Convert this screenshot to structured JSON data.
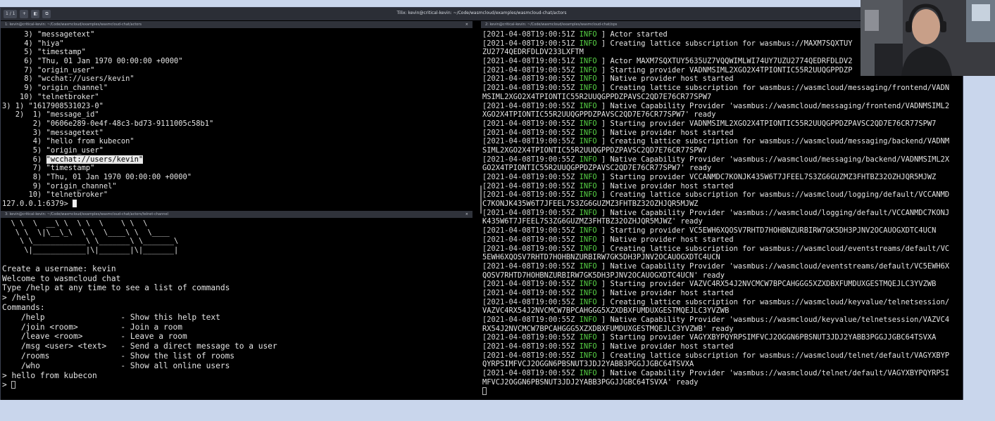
{
  "titlebar": {
    "tab_counter": "1 / 1",
    "title": "Tilix: kevin@critical-kevin: ~/Code/wasmcloud/examples/wasmcloud-chat/actors"
  },
  "panes": {
    "top_left_header": "1: kevin@critical-kevin: ~/Code/wasmcloud/examples/wasmcloud-chat/actors",
    "right_header": "2: kevin@critical-kevin: ~/Code/wasmcloud/examples/wasmcloud-chat/ops",
    "bottom_left_header": "3: kevin@critical-kevin: ~/Code/wasmcloud/examples/wasmcloud-chat/actors/telnet-channel",
    "close_glyph": "×"
  },
  "redis": {
    "lines": [
      "     3) \"messagetext\"",
      "     4) \"hiya\"",
      "     5) \"timestamp\"",
      "     6) \"Thu, 01 Jan 1970 00:00:00 +0000\"",
      "     7) \"origin_user\"",
      "     8) \"wcchat://users/kevin\"",
      "     9) \"origin_channel\"",
      "    10) \"telnetbroker\"",
      "3) 1) \"1617908531023-0\"",
      "   2)  1) \"message_id\"",
      "       2) \"0606e289-0e4f-48c3-bd73-9111005c58b1\"",
      "       3) \"messagetext\"",
      "       4) \"hello from kubecon\"",
      "       5) \"origin_user\""
    ],
    "hl_prefix": "       6) ",
    "hl_text": "\"wcchat://users/kevin\"",
    "lines_after": [
      "       7) \"timestamp\"",
      "       8) \"Thu, 01 Jan 1970 00:00:00 +0000\"",
      "       9) \"origin_channel\"",
      "      10) \"telnetbroker\""
    ],
    "prompt": "127.0.0.1:6379> "
  },
  "chat": {
    "ascii": [
      "  \\ \\  \\  __\\ \\  \\ \\  \\    \\ \\  \\",
      "   \\ \\  \\|\\__\\_\\  \\ \\  \\____\\ \\  \\____",
      "    \\ \\____________\\ \\_______\\ \\_______\\",
      "     \\|____________|\\|_______|\\|_______|"
    ],
    "lines": [
      "Create a username: kevin",
      "Welcome to wasmcloud chat",
      "Type /help at any time to see a list of commands",
      "> /help",
      "Commands:",
      "    /help                - Show this help text",
      "    /join <room>         - Join a room",
      "    /leave <room>        - Leave a room",
      "    /msg <user> <text>   - Send a direct message to a user",
      "    /rooms               - Show the list of rooms",
      "    /who                 - Show all online users",
      "> hello from kubecon"
    ],
    "prompt": "> "
  },
  "log": {
    "lines": [
      {
        "ts": "[2021-04-08T19:00:51Z",
        "lvl": "INFO",
        "msg": " ] Actor started"
      },
      {
        "ts": "[2021-04-08T19:00:51Z",
        "lvl": "INFO",
        "msg": " ] Creating lattice subscription for wasmbus://MAXM7SQXTUY"
      },
      {
        "ts": "",
        "lvl": "",
        "msg": "ZU2774QEDRFDLDV233LXFTM"
      },
      {
        "ts": "[2021-04-08T19:00:51Z",
        "lvl": "INFO",
        "msg": " ] Actor MAXM7SQXTUY5635UZ7VQQWIMLWI74UY7UZU2774QEDRFDLDV2"
      },
      {
        "ts": "[2021-04-08T19:00:55Z",
        "lvl": "INFO",
        "msg": " ] Starting provider VADNMSIML2XGO2X4TPIONTIC55R2UUQGPPDZP"
      },
      {
        "ts": "[2021-04-08T19:00:55Z",
        "lvl": "INFO",
        "msg": " ] Native provider host started"
      },
      {
        "ts": "[2021-04-08T19:00:55Z",
        "lvl": "INFO",
        "msg": " ] Creating lattice subscription for wasmbus://wasmcloud/messaging/frontend/VADN"
      },
      {
        "ts": "",
        "lvl": "",
        "msg": "MSIML2XGO2X4TPIONTIC55R2UUQGPPDZPAVSC2QD7E76CR77SPW7"
      },
      {
        "ts": "[2021-04-08T19:00:55Z",
        "lvl": "INFO",
        "msg": " ] Native Capability Provider 'wasmbus://wasmcloud/messaging/frontend/VADNMSIML2"
      },
      {
        "ts": "",
        "lvl": "",
        "msg": "XGO2X4TPIONTIC55R2UUQGPPDZPAVSC2QD7E76CR77SPW7' ready"
      },
      {
        "ts": "[2021-04-08T19:00:55Z",
        "lvl": "INFO",
        "msg": " ] Starting provider VADNMSIML2XGO2X4TPIONTIC55R2UUQGPPDZPAVSC2QD7E76CR77SPW7"
      },
      {
        "ts": "[2021-04-08T19:00:55Z",
        "lvl": "INFO",
        "msg": " ] Native provider host started"
      },
      {
        "ts": "[2021-04-08T19:00:55Z",
        "lvl": "INFO",
        "msg": " ] Creating lattice subscription for wasmbus://wasmcloud/messaging/backend/VADNM"
      },
      {
        "ts": "",
        "lvl": "",
        "msg": "SIML2XGO2X4TPIONTIC55R2UUQGPPDZPAVSC2QD7E76CR77SPW7"
      },
      {
        "ts": "[2021-04-08T19:00:55Z",
        "lvl": "INFO",
        "msg": " ] Native Capability Provider 'wasmbus://wasmcloud/messaging/backend/VADNMSIML2X"
      },
      {
        "ts": "",
        "lvl": "",
        "msg": "GO2X4TPIONTIC55R2UUQGPPDZPAVSC2QD7E76CR77SPW7' ready"
      },
      {
        "ts": "[2021-04-08T19:00:55Z",
        "lvl": "INFO",
        "msg": " ] Starting provider VCCANMDC7KONJK435W6T7JFEEL7S3ZG6GUZMZ3FHTBZ32OZHJQR5MJWZ"
      },
      {
        "ts": "[2021-04-08T19:00:55Z",
        "lvl": "INFO",
        "msg": " ] Native provider host started"
      },
      {
        "ts": "[2021-04-08T19:00:55Z",
        "lvl": "INFO",
        "msg": " ] Creating lattice subscription for wasmbus://wasmcloud/logging/default/VCCANMD"
      },
      {
        "ts": "",
        "lvl": "",
        "msg": "C7KONJK435W6T7JFEEL7S3ZG6GUZMZ3FHTBZ32OZHJQR5MJWZ"
      },
      {
        "ts": "[2021-04-08T19:00:55Z",
        "lvl": "INFO",
        "msg": " ] Native Capability Provider 'wasmbus://wasmcloud/logging/default/VCCANMDC7KONJ"
      },
      {
        "ts": "",
        "lvl": "",
        "msg": "K435W6T7JFEEL7S3ZG6GUZMZ3FHTBZ32OZHJQR5MJWZ' ready"
      },
      {
        "ts": "[2021-04-08T19:00:55Z",
        "lvl": "INFO",
        "msg": " ] Starting provider VC5EWH6XQOSV7RHTD7HOHBNZURBIRW7GK5DH3PJNV2OCAUOGXDTC4UCN"
      },
      {
        "ts": "[2021-04-08T19:00:55Z",
        "lvl": "INFO",
        "msg": " ] Native provider host started"
      },
      {
        "ts": "[2021-04-08T19:00:55Z",
        "lvl": "INFO",
        "msg": " ] Creating lattice subscription for wasmbus://wasmcloud/eventstreams/default/VC"
      },
      {
        "ts": "",
        "lvl": "",
        "msg": "5EWH6XQOSV7RHTD7HOHBNZURBIRW7GK5DH3PJNV2OCAUOGXDTC4UCN"
      },
      {
        "ts": "[2021-04-08T19:00:55Z",
        "lvl": "INFO",
        "msg": " ] Native Capability Provider 'wasmbus://wasmcloud/eventstreams/default/VC5EWH6X"
      },
      {
        "ts": "",
        "lvl": "",
        "msg": "QOSV7RHTD7HOHBNZURBIRW7GK5DH3PJNV2OCAUOGXDTC4UCN' ready"
      },
      {
        "ts": "[2021-04-08T19:00:55Z",
        "lvl": "INFO",
        "msg": " ] Starting provider VAZVC4RX54J2NVCMCW7BPCAHGGG5XZXDBXFUMDUXGESTMQEJLC3YVZWB"
      },
      {
        "ts": "[2021-04-08T19:00:55Z",
        "lvl": "INFO",
        "msg": " ] Native provider host started"
      },
      {
        "ts": "[2021-04-08T19:00:55Z",
        "lvl": "INFO",
        "msg": " ] Creating lattice subscription for wasmbus://wasmcloud/keyvalue/telnetsession/"
      },
      {
        "ts": "",
        "lvl": "",
        "msg": "VAZVC4RX54J2NVCMCW7BPCAHGGG5XZXDBXFUMDUXGESTMQEJLC3YVZWB"
      },
      {
        "ts": "[2021-04-08T19:00:55Z",
        "lvl": "INFO",
        "msg": " ] Native Capability Provider 'wasmbus://wasmcloud/keyvalue/telnetsession/VAZVC4"
      },
      {
        "ts": "",
        "lvl": "",
        "msg": "RX54J2NVCMCW7BPCAHGGG5XZXDBXFUMDUXGESTMQEJLC3YVZWB' ready"
      },
      {
        "ts": "[2021-04-08T19:00:55Z",
        "lvl": "INFO",
        "msg": " ] Starting provider VAGYXBYPQYRPSIMFVCJ2OGGN6PBSNUT3JDJ2YABB3PGGJJGBC64TSVXA"
      },
      {
        "ts": "[2021-04-08T19:00:55Z",
        "lvl": "INFO",
        "msg": " ] Native provider host started"
      },
      {
        "ts": "[2021-04-08T19:00:55Z",
        "lvl": "INFO",
        "msg": " ] Creating lattice subscription for wasmbus://wasmcloud/telnet/default/VAGYXBYP"
      },
      {
        "ts": "",
        "lvl": "",
        "msg": "QYRPSIMFVCJ2OGGN6PBSNUT3JDJ2YABB3PGGJJGBC64TSVXA"
      },
      {
        "ts": "[2021-04-08T19:00:55Z",
        "lvl": "INFO",
        "msg": " ] Native Capability Provider 'wasmbus://wasmcloud/telnet/default/VAGYXBYPQYRPSI"
      },
      {
        "ts": "",
        "lvl": "",
        "msg": "MFVCJ2OGGN6PBSNUT3JDJ2YABB3PGGJJGBC64TSVXA' ready"
      }
    ]
  },
  "colors": {
    "terminal_bg": "#000000",
    "info_green": "#58d246",
    "desktop_bg": "#c9d6ec"
  }
}
